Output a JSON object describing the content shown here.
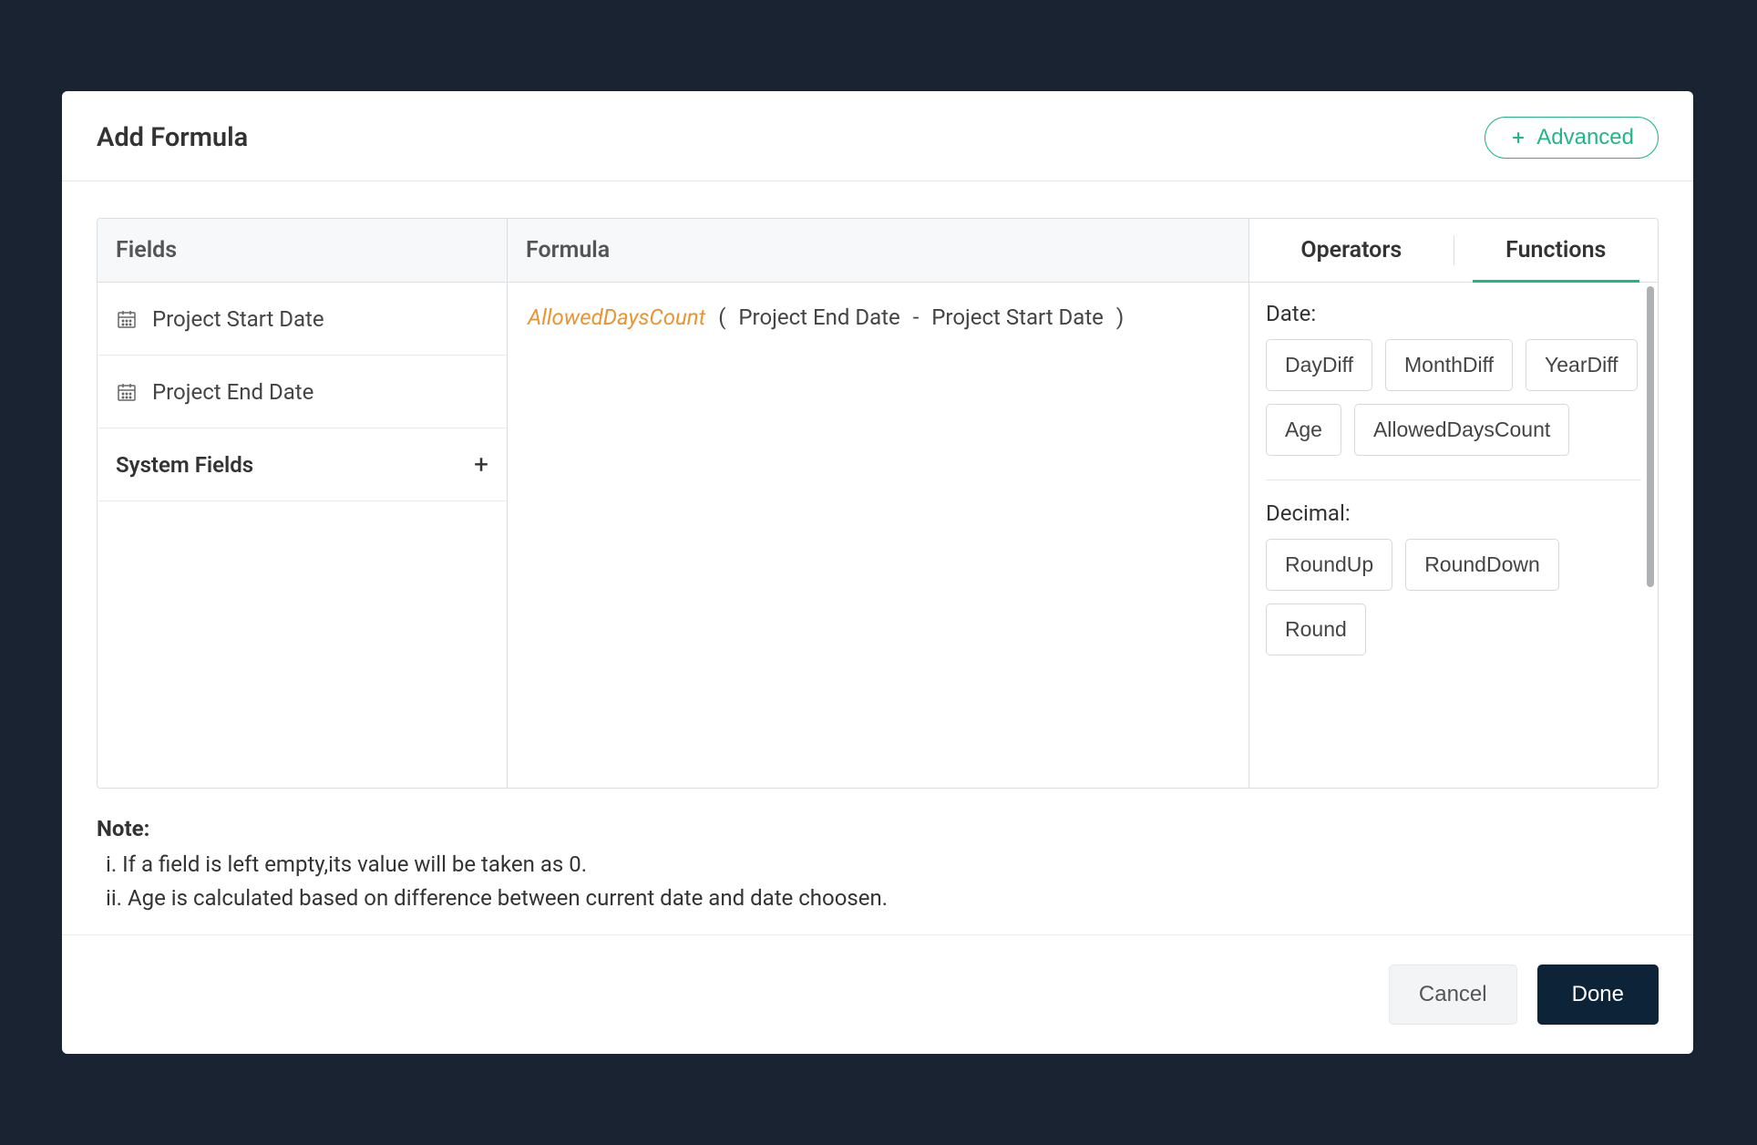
{
  "header": {
    "title": "Add Formula",
    "advanced_label": "Advanced"
  },
  "fields": {
    "header": "Fields",
    "items": [
      {
        "label": "Project Start Date"
      },
      {
        "label": "Project End Date"
      }
    ],
    "system_label": "System Fields"
  },
  "formula": {
    "header": "Formula",
    "func": "AllowedDaysCount",
    "open": "(",
    "token1": "Project End Date",
    "minus": "-",
    "token2": "Project Start Date",
    "close": ")"
  },
  "right": {
    "tabs": {
      "operators": "Operators",
      "functions": "Functions"
    },
    "groups": [
      {
        "label": "Date:",
        "items": [
          "DayDiff",
          "MonthDiff",
          "YearDiff",
          "Age",
          "AllowedDaysCount"
        ]
      },
      {
        "label": "Decimal:",
        "items": [
          "RoundUp",
          "RoundDown",
          "Round"
        ]
      }
    ]
  },
  "note": {
    "title": "Note:",
    "line1": "i. If a field is left empty,its value will be taken as 0.",
    "line2": "ii. Age is calculated based on difference between current date and date choosen."
  },
  "footer": {
    "cancel": "Cancel",
    "done": "Done"
  }
}
